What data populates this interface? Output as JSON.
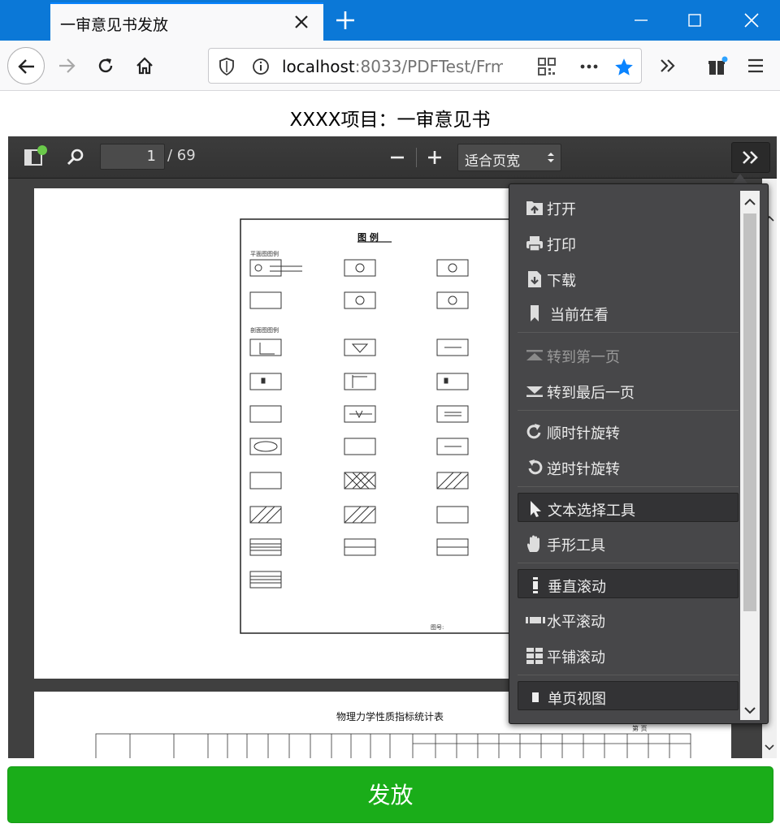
{
  "browser": {
    "tab_title": "一审意见书发放",
    "url_host": "localhost",
    "url_rest": ":8033/PDFTest/Frm"
  },
  "page": {
    "title": "XXXX项目：一审意见书"
  },
  "viewer": {
    "page_number": "1",
    "page_count": "/ 69",
    "zoom_label": "适合页宽"
  },
  "menu": {
    "items": [
      {
        "label": "打开",
        "icon": "open-icon"
      },
      {
        "label": "打印",
        "icon": "print-icon"
      },
      {
        "label": "下载",
        "icon": "download-icon"
      },
      {
        "label": "当前在看",
        "icon": "bookmark-icon"
      },
      {
        "label": "转到第一页",
        "icon": "first-page-icon",
        "disabled": true
      },
      {
        "label": "转到最后一页",
        "icon": "last-page-icon"
      },
      {
        "label": "顺时针旋转",
        "icon": "rotate-cw-icon"
      },
      {
        "label": "逆时针旋转",
        "icon": "rotate-ccw-icon"
      },
      {
        "label": "文本选择工具",
        "icon": "text-cursor-icon",
        "selected": true
      },
      {
        "label": "手形工具",
        "icon": "hand-icon"
      },
      {
        "label": "垂直滚动",
        "icon": "vertical-scroll-icon",
        "selected": true
      },
      {
        "label": "水平滚动",
        "icon": "horizontal-scroll-icon"
      },
      {
        "label": "平铺滚动",
        "icon": "wrapped-scroll-icon"
      },
      {
        "label": "单页视图",
        "icon": "single-page-icon",
        "selected": true
      }
    ]
  },
  "pdf": {
    "legend_title": "图 例",
    "legend_subtitle_1": "平面图图例",
    "legend_subtitle_2": "剖面图图例",
    "legend_footer": "图号:",
    "table_title": "物理力学性质指标统计表",
    "table_page": "第  页"
  },
  "actions": {
    "issue_label": "发放"
  },
  "colors": {
    "titlebar": "#0b78d7",
    "issue_button": "#1aad19",
    "bookmark_star": "#0a84ff"
  }
}
